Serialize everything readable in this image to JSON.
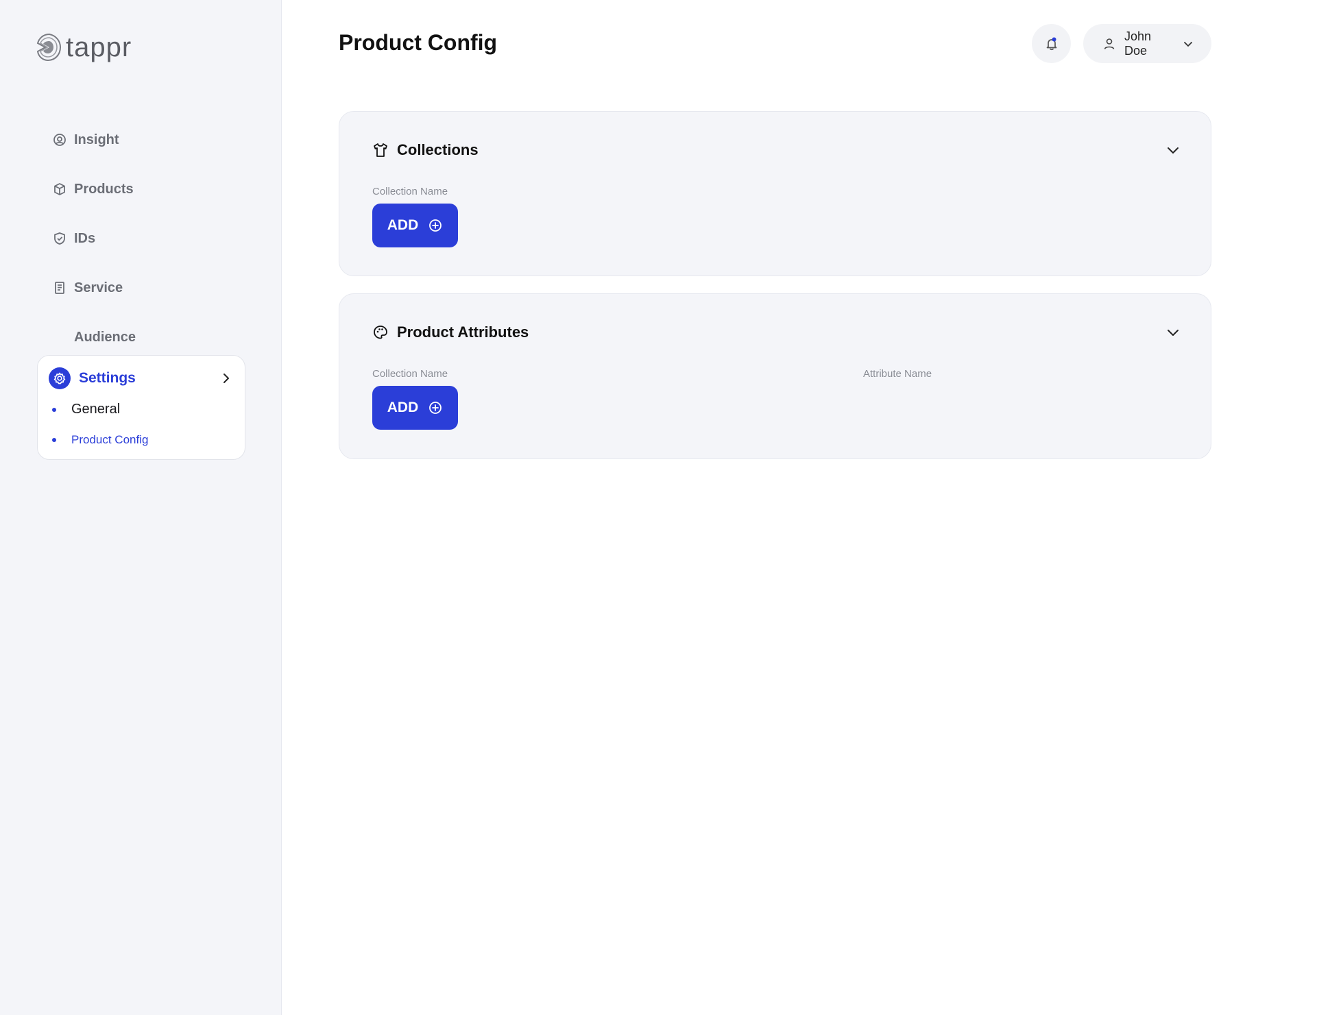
{
  "app": {
    "logo_text": "tappr",
    "page_title": "Product Config"
  },
  "header": {
    "user_name": "John Doe"
  },
  "sidebar": {
    "items": [
      {
        "label": "Insight",
        "icon": "insight-icon"
      },
      {
        "label": "Products",
        "icon": "box-icon"
      },
      {
        "label": "IDs",
        "icon": "shield-check-icon"
      },
      {
        "label": "Service",
        "icon": "receipt-icon"
      },
      {
        "label": "Audience",
        "icon": ""
      }
    ],
    "settings": {
      "label": "Settings",
      "sub_items": [
        {
          "label": "General"
        },
        {
          "label": "Product Config",
          "active": true
        }
      ]
    }
  },
  "panels": {
    "collections": {
      "title": "Collections",
      "fields": [
        "Collection Name"
      ],
      "add_label": "ADD"
    },
    "attributes": {
      "title": "Product Attributes",
      "fields": [
        "Collection Name",
        "Attribute Name"
      ],
      "add_label": "ADD"
    }
  },
  "colors": {
    "accent": "#2b3ed8",
    "sidebar_bg": "#f4f5f9",
    "panel_bg": "#f4f5f9",
    "muted_text": "#6b6e76"
  }
}
